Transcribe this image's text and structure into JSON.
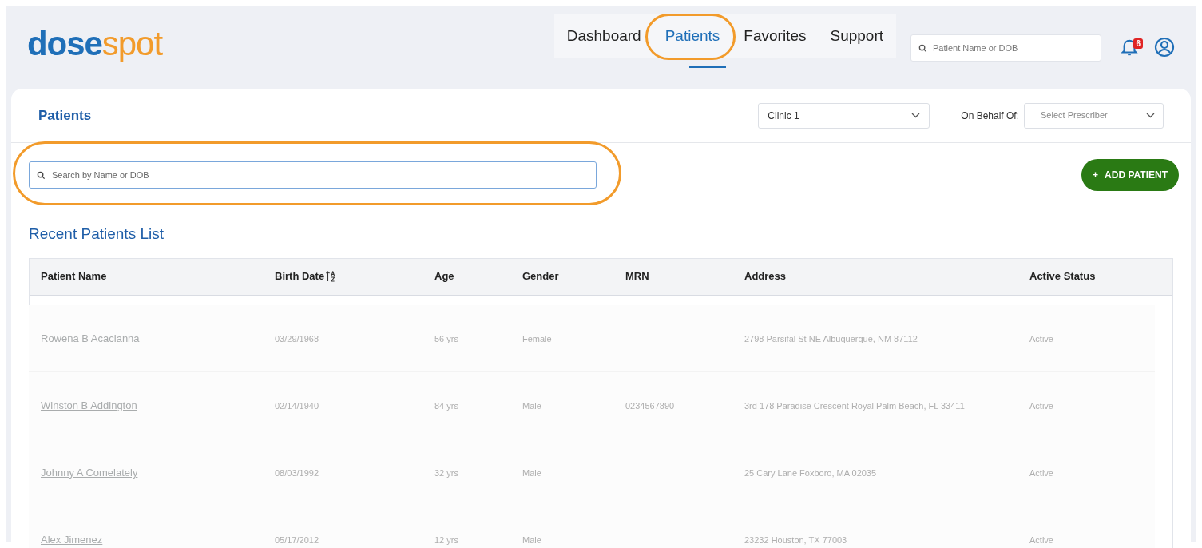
{
  "logo": {
    "first": "dose",
    "second": "spot"
  },
  "nav_tabs": [
    {
      "label": "Dashboard",
      "selected": false
    },
    {
      "label": "Patients",
      "selected": true,
      "highlighted": true
    },
    {
      "label": "Favorites",
      "selected": false
    },
    {
      "label": "Support",
      "selected": false
    }
  ],
  "header_search": {
    "placeholder": "Patient Name or DOB"
  },
  "notifications": {
    "count": "6"
  },
  "page": {
    "title": "Patients",
    "clinic_select": {
      "value": "Clinic 1"
    },
    "on_behalf_label": "On Behalf Of:",
    "prescriber_select": {
      "placeholder": "Select Prescriber"
    }
  },
  "patient_search": {
    "placeholder": "Search by Name or DOB",
    "highlighted": true
  },
  "add_button": {
    "icon": "+",
    "label": "ADD PATIENT"
  },
  "list_title": "Recent Patients List",
  "table": {
    "columns": [
      {
        "label": "Patient Name",
        "kind": "plain"
      },
      {
        "label": "Birth Date",
        "kind": "sortable"
      },
      {
        "label": "Age",
        "kind": "plain"
      },
      {
        "label": "Gender",
        "kind": "plain"
      },
      {
        "label": "MRN",
        "kind": "plain"
      },
      {
        "label": "Address",
        "kind": "plain"
      },
      {
        "label": "Active Status",
        "kind": "plain"
      }
    ],
    "rows": [
      {
        "cells": [
          "Rowena B Acacianna",
          "03/29/1968",
          "56 yrs",
          "Female",
          "",
          "2798 Parsifal St NE Albuquerque, NM 87112",
          "Active"
        ]
      },
      {
        "cells": [
          "Winston B Addington",
          "02/14/1940",
          "84 yrs",
          "Male",
          "0234567890",
          "3rd 178 Paradise Crescent Royal Palm Beach, FL 33411",
          "Active"
        ]
      },
      {
        "cells": [
          "Johnny A Comelately",
          "08/03/1992",
          "32 yrs",
          "Male",
          "",
          "25 Cary Lane Foxboro, MA 02035",
          "Active"
        ]
      },
      {
        "cells": [
          "Alex Jimenez",
          "05/17/2012",
          "12 yrs",
          "Male",
          "",
          "23232 Houston, TX 77003",
          "Active"
        ]
      }
    ]
  }
}
